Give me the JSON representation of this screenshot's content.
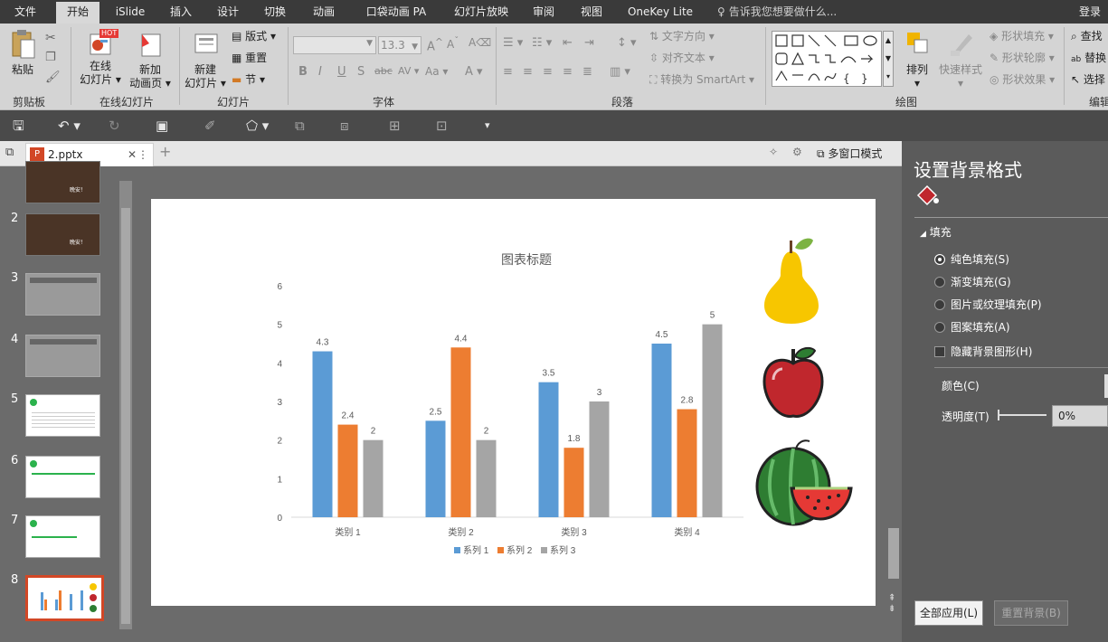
{
  "menu": {
    "file": "文件",
    "tabs": [
      "开始",
      "iSlide",
      "插入",
      "设计",
      "切换",
      "动画",
      "口袋动画 PA",
      "幻灯片放映",
      "审阅",
      "视图",
      "OneKey Lite"
    ],
    "tell_me": "告诉我您想要做什么...",
    "login": "登录"
  },
  "ribbon": {
    "paste": "粘贴",
    "clipboard": "剪贴板",
    "online_slides_line1": "在线",
    "online_slides_line2": "幻灯片",
    "new_anim_line1": "新加",
    "new_anim_line2": "动画页",
    "online_group": "在线幻灯片",
    "hot_badge": "HOT",
    "new_slide_line1": "新建",
    "new_slide_line2": "幻灯片",
    "layout": "版式",
    "reset": "重置",
    "section": "节",
    "slides_group": "幻灯片",
    "font_size": "13.3",
    "font_group": "字体",
    "text_direction": "文字方向",
    "align_text": "对齐文本",
    "smartart": "转换为 SmartArt",
    "paragraph_group": "段落",
    "arrange": "排列",
    "quick_styles": "快速样式",
    "shape_fill": "形状填充",
    "shape_outline": "形状轮廓",
    "shape_effects": "形状效果",
    "drawing_group": "绘图",
    "find": "查找",
    "replace": "替换",
    "select": "选择",
    "editing_group": "编辑"
  },
  "doc_tab": {
    "name": "2.pptx",
    "multi_window": "多窗口模式"
  },
  "thumbnails": [
    "2",
    "3",
    "4",
    "5",
    "6",
    "7",
    "8"
  ],
  "thumb_text": "晚安！",
  "pane": {
    "title": "设置背景格式",
    "fill_section": "填充",
    "options": [
      "纯色填充(S)",
      "渐变填充(G)",
      "图片或纹理填充(P)",
      "图案填充(A)"
    ],
    "hide_bg": "隐藏背景图形(H)",
    "color_label": "颜色(C)",
    "transparency_label": "透明度(T)",
    "transparency_value": "0%",
    "apply_all": "全部应用(L)",
    "reset_bg": "重置背景(B)"
  },
  "colors": {
    "series1": "#5b9bd5",
    "series2": "#ed7d31",
    "series3": "#a5a5a5",
    "accent": "#d24726"
  },
  "chart_data": {
    "type": "bar",
    "title": "图表标题",
    "categories": [
      "类别 1",
      "类别 2",
      "类别 3",
      "类别 4"
    ],
    "series": [
      {
        "name": "系列 1",
        "values": [
          4.3,
          2.5,
          3.5,
          4.5
        ]
      },
      {
        "name": "系列 2",
        "values": [
          2.4,
          4.4,
          1.8,
          2.8
        ]
      },
      {
        "name": "系列 3",
        "values": [
          2,
          2,
          3,
          5
        ]
      }
    ],
    "yticks": [
      0,
      1,
      2,
      3,
      4,
      5,
      6
    ],
    "ylim": [
      0,
      6
    ],
    "legend": "bottom",
    "grid": false
  }
}
